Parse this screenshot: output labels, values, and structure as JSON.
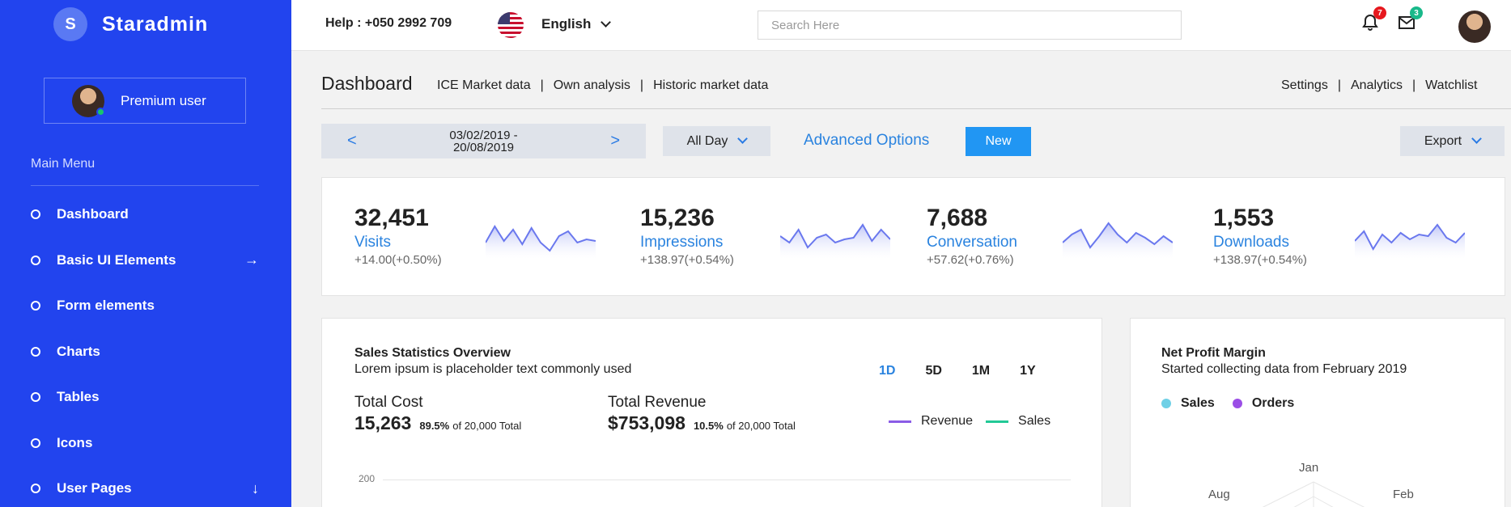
{
  "brand": {
    "initial": "S",
    "name": "Staradmin"
  },
  "user": {
    "name": "Premium user"
  },
  "sidebar": {
    "heading": "Main Menu",
    "items": [
      {
        "label": "Dashboard",
        "arrow": ""
      },
      {
        "label": "Basic UI Elements",
        "arrow": "→"
      },
      {
        "label": "Form elements",
        "arrow": ""
      },
      {
        "label": "Charts",
        "arrow": ""
      },
      {
        "label": "Tables",
        "arrow": ""
      },
      {
        "label": "Icons",
        "arrow": ""
      },
      {
        "label": "User Pages",
        "arrow": "↓"
      }
    ]
  },
  "topbar": {
    "help": "Help : +050 2992 709",
    "language": "English",
    "search_placeholder": "Search Here",
    "notifications_count": "7",
    "messages_count": "3"
  },
  "header": {
    "title": "Dashboard",
    "links": [
      "ICE Market data",
      "Own analysis",
      "Historic market data"
    ],
    "right_links": [
      "Settings",
      "Analytics",
      "Watchlist"
    ]
  },
  "toolbar": {
    "prev": "<",
    "next": ">",
    "date_from": "03/02/2019 -",
    "date_to": "20/08/2019",
    "period": "All Day",
    "advanced": "Advanced Options",
    "new": "New",
    "export": "Export"
  },
  "stats": [
    {
      "value": "32,451",
      "label": "Visits",
      "change": "+14.00(+0.50%)",
      "spark": [
        30,
        10,
        28,
        14,
        32,
        12,
        30,
        40,
        22,
        16,
        30,
        26,
        28
      ]
    },
    {
      "value": "15,236",
      "label": "Impressions",
      "change": "+138.97(+0.54%)",
      "spark": [
        22,
        30,
        14,
        36,
        24,
        20,
        30,
        26,
        24,
        8,
        28,
        14,
        26
      ]
    },
    {
      "value": "7,688",
      "label": "Conversation",
      "change": "+57.62(+0.76%)",
      "spark": [
        30,
        20,
        14,
        36,
        22,
        6,
        20,
        30,
        18,
        24,
        32,
        22,
        30
      ]
    },
    {
      "value": "1,553",
      "label": "Downloads",
      "change": "+138.97(+0.54%)",
      "spark": [
        28,
        16,
        38,
        20,
        30,
        18,
        26,
        20,
        22,
        8,
        24,
        30,
        18
      ]
    }
  ],
  "colors": {
    "sidebar": "#2244ee",
    "accent": "#2a83df",
    "spark_line": "#6a78ee",
    "revenue": "#8a5ce6",
    "sales": "#22c996",
    "sales_dot": "#6fd0e6",
    "orders_dot": "#9b4ee6"
  },
  "sales_card": {
    "title": "Sales Statistics Overview",
    "subtitle": "Lorem ipsum is placeholder text commonly used",
    "ranges": [
      "1D",
      "5D",
      "1M",
      "1Y"
    ],
    "active_range": "1D",
    "total_cost": {
      "label": "Total Cost",
      "value": "15,263",
      "pct": "89.5%",
      "of": "of 20,000 Total"
    },
    "total_revenue": {
      "label": "Total Revenue",
      "value": "$753,098",
      "pct": "10.5%",
      "of": "of 20,000 Total"
    },
    "legend": [
      "Revenue",
      "Sales"
    ],
    "y_tick": "200"
  },
  "profit_card": {
    "title": "Net Profit Margin",
    "subtitle": "Started collecting data from February 2019",
    "legend": [
      "Sales",
      "Orders"
    ],
    "radar_labels": [
      "Jan",
      "Aug",
      "Feb"
    ]
  }
}
